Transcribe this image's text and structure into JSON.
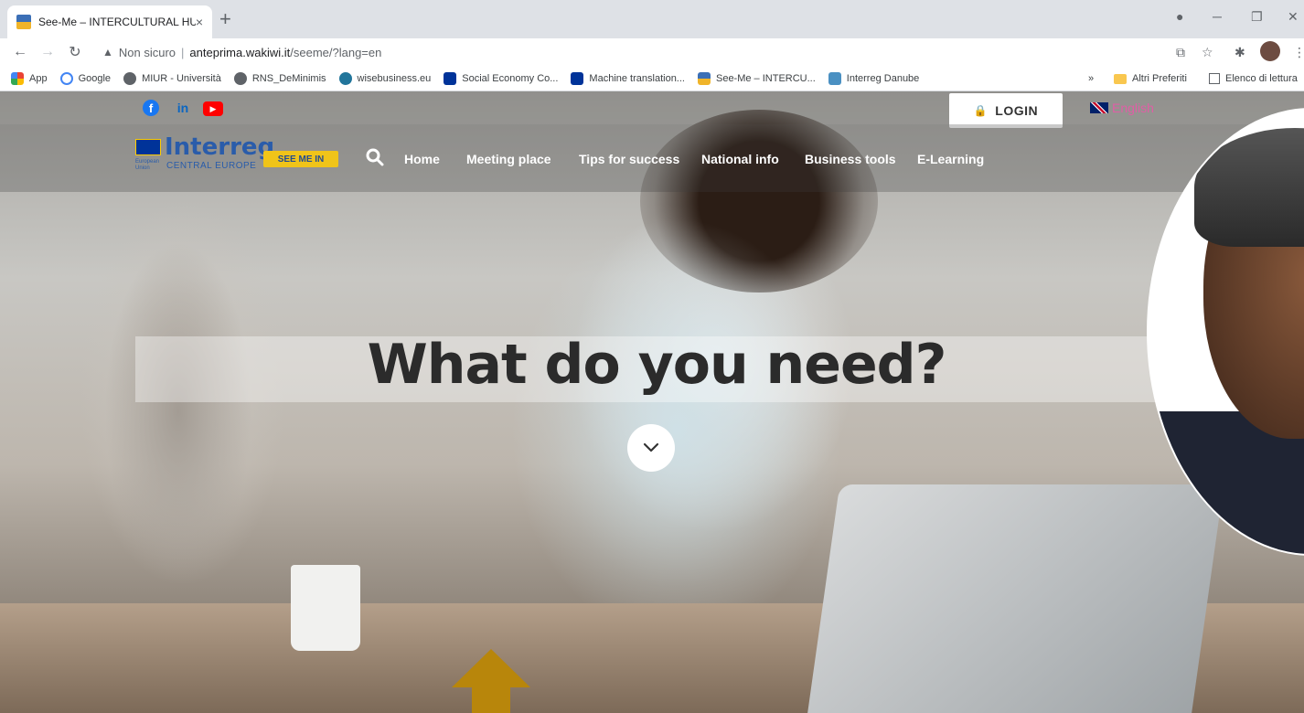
{
  "browser": {
    "tab_title": "See-Me – INTERCULTURAL HUB",
    "tab_close": "×",
    "new_tab": "+",
    "address": {
      "security_label": "Non sicuro",
      "separator": "|",
      "host": "anteprima.wakiwi.it",
      "path": "/seeme/?lang=en"
    },
    "bookmarks": [
      {
        "label": "App",
        "color": "#1a73e8"
      },
      {
        "label": "Google",
        "color": "#4285f4"
      },
      {
        "label": "MIUR - Università",
        "color": "#5f6368"
      },
      {
        "label": "RNS_DeMinimis",
        "color": "#5f6368"
      },
      {
        "label": "wisebusiness.eu",
        "color": "#21759b"
      },
      {
        "label": "Social Economy Co...",
        "color": "#003399"
      },
      {
        "label": "Machine translation...",
        "color": "#003399"
      },
      {
        "label": "See-Me – INTERCU...",
        "color": "#3b6fb6"
      },
      {
        "label": "Interreg Danube",
        "color": "#4a90c2"
      }
    ],
    "bookmarks_more": "»",
    "other_bookmarks": "Altri Preferiti",
    "reading_list": "Elenco di lettura"
  },
  "site": {
    "login_label": "LOGIN",
    "language": "English",
    "logo_text": "Interreg",
    "logo_subtitle": "CENTRAL EUROPE",
    "logo_eu": "European Union",
    "badge": "SEE ME IN",
    "nav": [
      {
        "label": "Home"
      },
      {
        "label": "Meeting place"
      },
      {
        "label": "Tips for success"
      },
      {
        "label": "National info"
      },
      {
        "label": "Business tools"
      },
      {
        "label": "E-Learning"
      }
    ],
    "hero_title": "What do you need?"
  },
  "colors": {
    "accent_pink": "#e05ea5",
    "interreg_blue": "#2a5caa",
    "badge_yellow": "#f0c419",
    "arrow_gold": "#b8860b"
  }
}
